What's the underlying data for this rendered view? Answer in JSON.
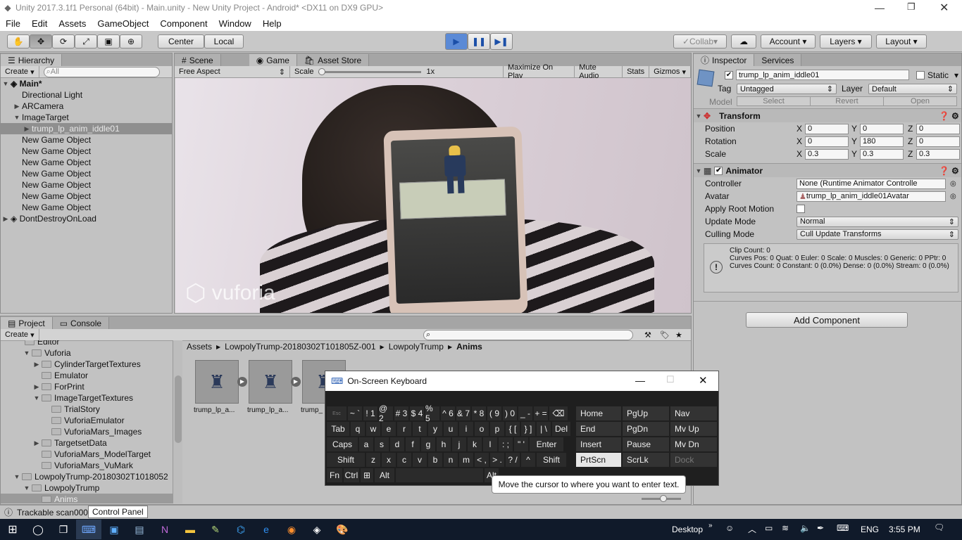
{
  "window": {
    "title": "Unity 2017.3.1f1 Personal (64bit) - Main.unity - New Unity Project - Android* <DX11 on DX9 GPU>"
  },
  "menu": [
    "File",
    "Edit",
    "Assets",
    "GameObject",
    "Component",
    "Window",
    "Help"
  ],
  "toolbar": {
    "center": "Center",
    "local": "Local",
    "collab": "Collab",
    "account": "Account",
    "layers": "Layers",
    "layout": "Layout"
  },
  "hierarchy": {
    "tab": "Hierarchy",
    "create": "Create",
    "search_placeholder": "All",
    "scene": "Main*",
    "items": [
      "Directional Light",
      "ARCamera",
      "ImageTarget",
      "trump_lp_anim_iddle01",
      "New Game Object",
      "New Game Object",
      "New Game Object",
      "New Game Object",
      "New Game Object",
      "New Game Object",
      "New Game Object"
    ],
    "ddol": "DontDestroyOnLoad"
  },
  "view_tabs": {
    "scene": "Scene",
    "game": "Game",
    "asset_store": "Asset Store"
  },
  "game_bar": {
    "aspect": "Free Aspect",
    "scale_label": "Scale",
    "scale_value": "1x",
    "maximize": "Maximize On Play",
    "mute": "Mute Audio",
    "stats": "Stats",
    "gizmos": "Gizmos"
  },
  "game_view": {
    "watermark": "vuforia"
  },
  "inspector": {
    "tab": "Inspector",
    "services": "Services",
    "object_name": "trump_lp_anim_iddle01",
    "static": "Static",
    "tag_label": "Tag",
    "tag": "Untagged",
    "layer_label": "Layer",
    "layer": "Default",
    "model_label": "Model",
    "select": "Select",
    "revert": "Revert",
    "open": "Open",
    "transform": "Transform",
    "position": {
      "label": "Position",
      "x": "0",
      "y": "0",
      "z": "0"
    },
    "rotation": {
      "label": "Rotation",
      "x": "0",
      "y": "180",
      "z": "0"
    },
    "scale": {
      "label": "Scale",
      "x": "0.3",
      "y": "0.3",
      "z": "0.3"
    },
    "animator": "Animator",
    "controller_label": "Controller",
    "controller": "None (Runtime Animator Controlle",
    "avatar_label": "Avatar",
    "avatar": "trump_lp_anim_iddle01Avatar",
    "root_motion": "Apply Root Motion",
    "update_label": "Update Mode",
    "update": "Normal",
    "culling_label": "Culling Mode",
    "culling": "Cull Update Transforms",
    "info1": "Clip Count: 0",
    "info2": "Curves Pos: 0 Quat: 0 Euler: 0 Scale: 0 Muscles: 0 Generic: 0 PPtr: 0",
    "info3": "Curves Count: 0 Constant: 0 (0.0%) Dense: 0 (0.0%) Stream: 0 (0.0%)",
    "add_component": "Add Component"
  },
  "project": {
    "tab": "Project",
    "console": "Console",
    "create": "Create",
    "tree": [
      "Editor",
      "Vuforia",
      "CylinderTargetTextures",
      "Emulator",
      "ForPrint",
      "ImageTargetTextures",
      "TrialStory",
      "VuforiaEmulator",
      "VuforiaMars_Images",
      "TargetsetData",
      "VuforiaMars_ModelTarget",
      "VuforiaMars_VuMark",
      "LowpolyTrump-20180302T1018052",
      "LowpolyTrump",
      "Anims"
    ],
    "breadcrumb": [
      "Assets",
      "LowpolyTrump-20180302T101805Z-001",
      "LowpolyTrump",
      "Anims"
    ],
    "assets": [
      "trump_lp_a...",
      "trump_lp_a...",
      "trump_"
    ]
  },
  "status": {
    "text": "Trackable scan000",
    "tooltip": "Control Panel"
  },
  "osk": {
    "title": "On-Screen Keyboard",
    "row1": [
      "Esc",
      "~ `",
      "! 1",
      "@ 2",
      "# 3",
      "$ 4",
      "% 5",
      "^ 6",
      "& 7",
      "* 8",
      "( 9",
      ") 0",
      "_ -",
      "+ =",
      "⌫"
    ],
    "row2": [
      "Tab",
      "q",
      "w",
      "e",
      "r",
      "t",
      "y",
      "u",
      "i",
      "o",
      "p",
      "{ [",
      "} ]",
      "| \\",
      "Del"
    ],
    "row3": [
      "Caps",
      "a",
      "s",
      "d",
      "f",
      "g",
      "h",
      "j",
      "k",
      "l",
      ": ;",
      "\" '",
      "Enter"
    ],
    "row4": [
      "Shift",
      "z",
      "x",
      "c",
      "v",
      "b",
      "n",
      "m",
      "< ,",
      "> .",
      "? /",
      "^",
      "Shift"
    ],
    "row5": [
      "Fn",
      "Ctrl",
      "⊞",
      "Alt",
      "",
      "Alt"
    ],
    "nav": [
      [
        "Home",
        "PgUp",
        "Nav"
      ],
      [
        "End",
        "PgDn",
        "Mv Up"
      ],
      [
        "Insert",
        "Pause",
        "Mv Dn"
      ],
      [
        "PrtScn",
        "ScrLk",
        "Dock"
      ]
    ],
    "tooltip": "Move the cursor to where you want to enter text."
  },
  "taskbar": {
    "desktop": "Desktop",
    "lang": "ENG",
    "time": "3:55 PM"
  }
}
